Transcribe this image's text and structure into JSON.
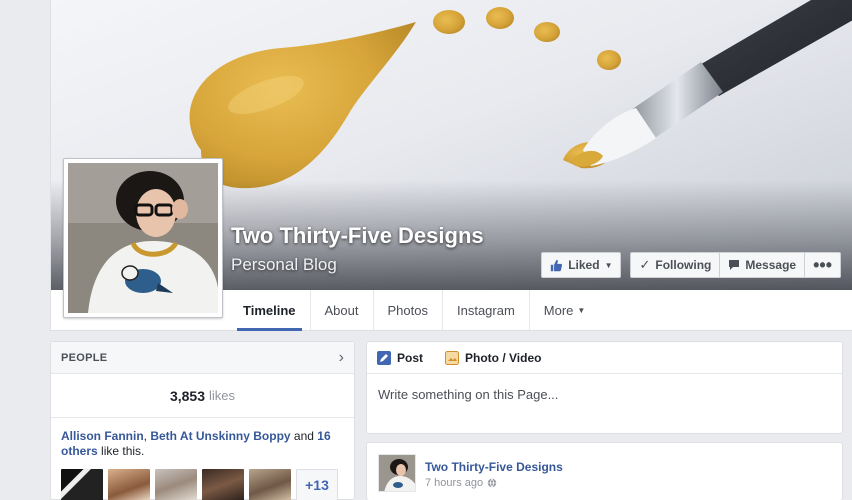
{
  "page": {
    "name": "Two Thirty-Five Designs",
    "category": "Personal Blog"
  },
  "actions": {
    "liked_label": "Liked",
    "following_label": "Following",
    "message_label": "Message",
    "more_label": "•••"
  },
  "tabs": [
    {
      "label": "Timeline",
      "active": true
    },
    {
      "label": "About"
    },
    {
      "label": "Photos"
    },
    {
      "label": "Instagram"
    },
    {
      "label": "More"
    }
  ],
  "people": {
    "title": "PEOPLE",
    "likes_count": "3,853",
    "likes_unit": "likes",
    "friend1": "Allison Fannin",
    "friend2": "Beth At Unskinny Boppy",
    "and_text": "and",
    "others": "16 others",
    "like_this": "like this.",
    "more_count": "+13"
  },
  "composer": {
    "post_tab": "Post",
    "photo_tab": "Photo / Video",
    "placeholder": "Write something on this Page..."
  },
  "post": {
    "author": "Two Thirty-Five Designs",
    "time": "7 hours ago"
  },
  "colors": {
    "accent": "#4267b2",
    "link": "#365899",
    "paint": "#d9a93a"
  }
}
